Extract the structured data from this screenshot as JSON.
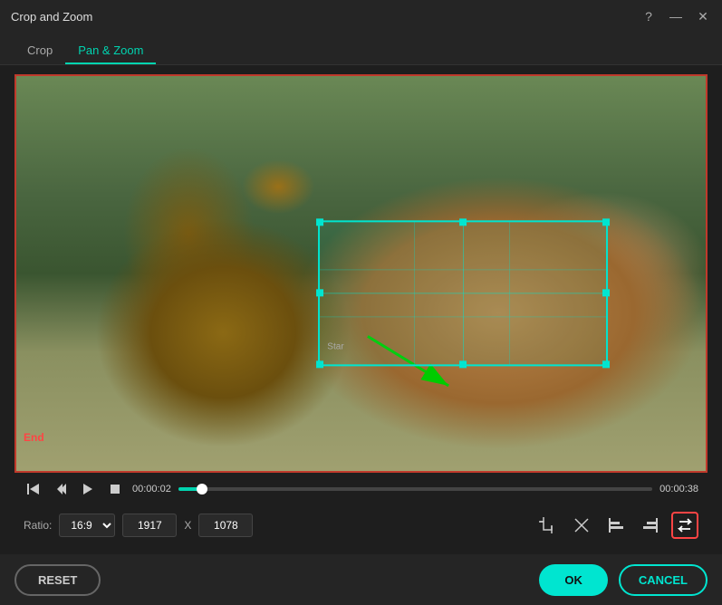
{
  "titlebar": {
    "title": "Crop and Zoom",
    "help_icon": "?",
    "minimize_icon": "—",
    "close_icon": "✕"
  },
  "tabs": [
    {
      "id": "crop",
      "label": "Crop"
    },
    {
      "id": "pan-zoom",
      "label": "Pan & Zoom",
      "active": true
    }
  ],
  "video": {
    "end_label": "End"
  },
  "playback": {
    "current_time": "00:00:02",
    "total_time": "00:00:38",
    "progress_percent": 5
  },
  "options": {
    "ratio_label": "Ratio:",
    "ratio_value": "16:9",
    "width": "1917",
    "x_label": "X",
    "height": "1078"
  },
  "icons": {
    "crop_icon": "✂",
    "transform_icon": "✕",
    "align_left_icon": "⊢",
    "align_right_icon": "⊣",
    "swap_icon": "⇆"
  },
  "actions": {
    "reset_label": "RESET",
    "ok_label": "OK",
    "cancel_label": "CANCEL"
  },
  "selection": {
    "star_label": "Star"
  }
}
